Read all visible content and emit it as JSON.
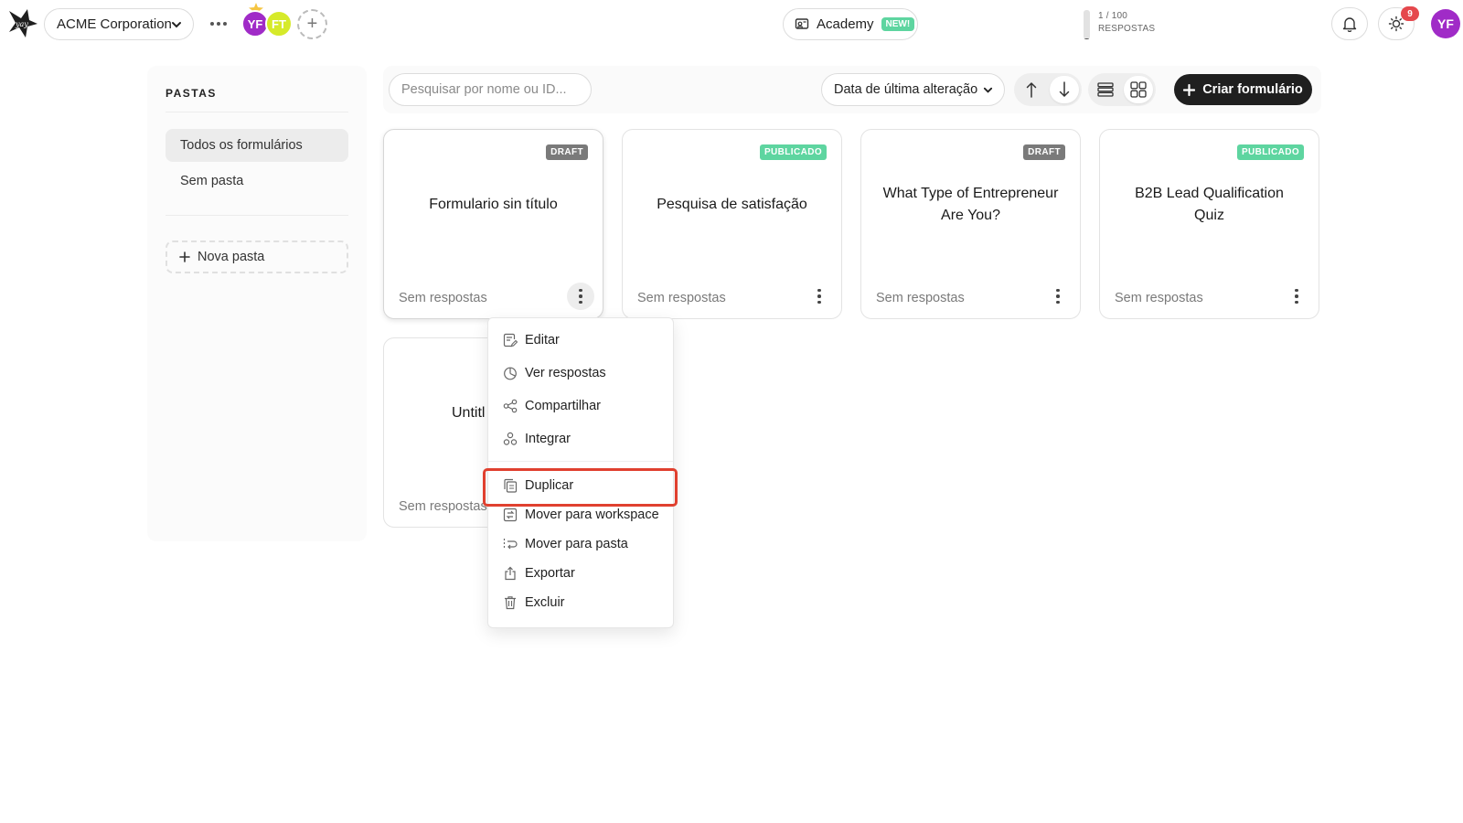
{
  "header": {
    "workspace": "ACME Corporation",
    "members": [
      {
        "initials": "YF",
        "color": "#a02bc7"
      },
      {
        "initials": "FT",
        "color": "#d6ea2a"
      }
    ],
    "academy_label": "Academy",
    "academy_badge": "NEW!",
    "quota_count": "1 / 100",
    "quota_label": "RESPOSTAS",
    "quota_fraction": 0.01,
    "notifications_count": "9",
    "user_initials": "YF"
  },
  "sidebar": {
    "title": "PASTAS",
    "items": [
      {
        "label": "Todos os formulários",
        "active": true
      },
      {
        "label": "Sem pasta",
        "active": false
      }
    ],
    "new_folder_label": "Nova pasta"
  },
  "toolbar": {
    "search_placeholder": "Pesquisar por nome ou ID...",
    "search_value": "",
    "sort_label": "Data de última alteração",
    "create_label": "Criar formulário"
  },
  "forms": [
    {
      "title": "Formulario sin título",
      "status": "DRAFT",
      "responses": "Sem respostas"
    },
    {
      "title": "Pesquisa de satisfação",
      "status": "PUBLICADO",
      "responses": "Sem respostas"
    },
    {
      "title": "What Type of Entrepreneur Are You?",
      "status": "DRAFT",
      "responses": "Sem respostas"
    },
    {
      "title": "B2B Lead Qualification Quiz",
      "status": "PUBLICADO",
      "responses": "Sem respostas"
    },
    {
      "title": "Untitl",
      "status": "",
      "responses": "Sem respostas"
    }
  ],
  "context_menu": {
    "items": [
      {
        "label": "Editar",
        "icon": "edit-icon"
      },
      {
        "label": "Ver respostas",
        "icon": "chart-icon"
      },
      {
        "label": "Compartilhar",
        "icon": "share-icon"
      },
      {
        "label": "Integrar",
        "icon": "integrate-icon"
      },
      {
        "label": "Duplicar",
        "icon": "duplicate-icon"
      },
      {
        "label": "Mover para workspace",
        "icon": "move-workspace-icon"
      },
      {
        "label": "Mover para pasta",
        "icon": "move-folder-icon"
      },
      {
        "label": "Exportar",
        "icon": "export-icon"
      },
      {
        "label": "Excluir",
        "icon": "trash-icon"
      }
    ]
  },
  "colors": {
    "accent_dark": "#1f1f1f",
    "published": "#5ed5a0",
    "draft": "#7a7a7a",
    "highlight": "#e0402f",
    "avatar_purple": "#a02bc7"
  }
}
